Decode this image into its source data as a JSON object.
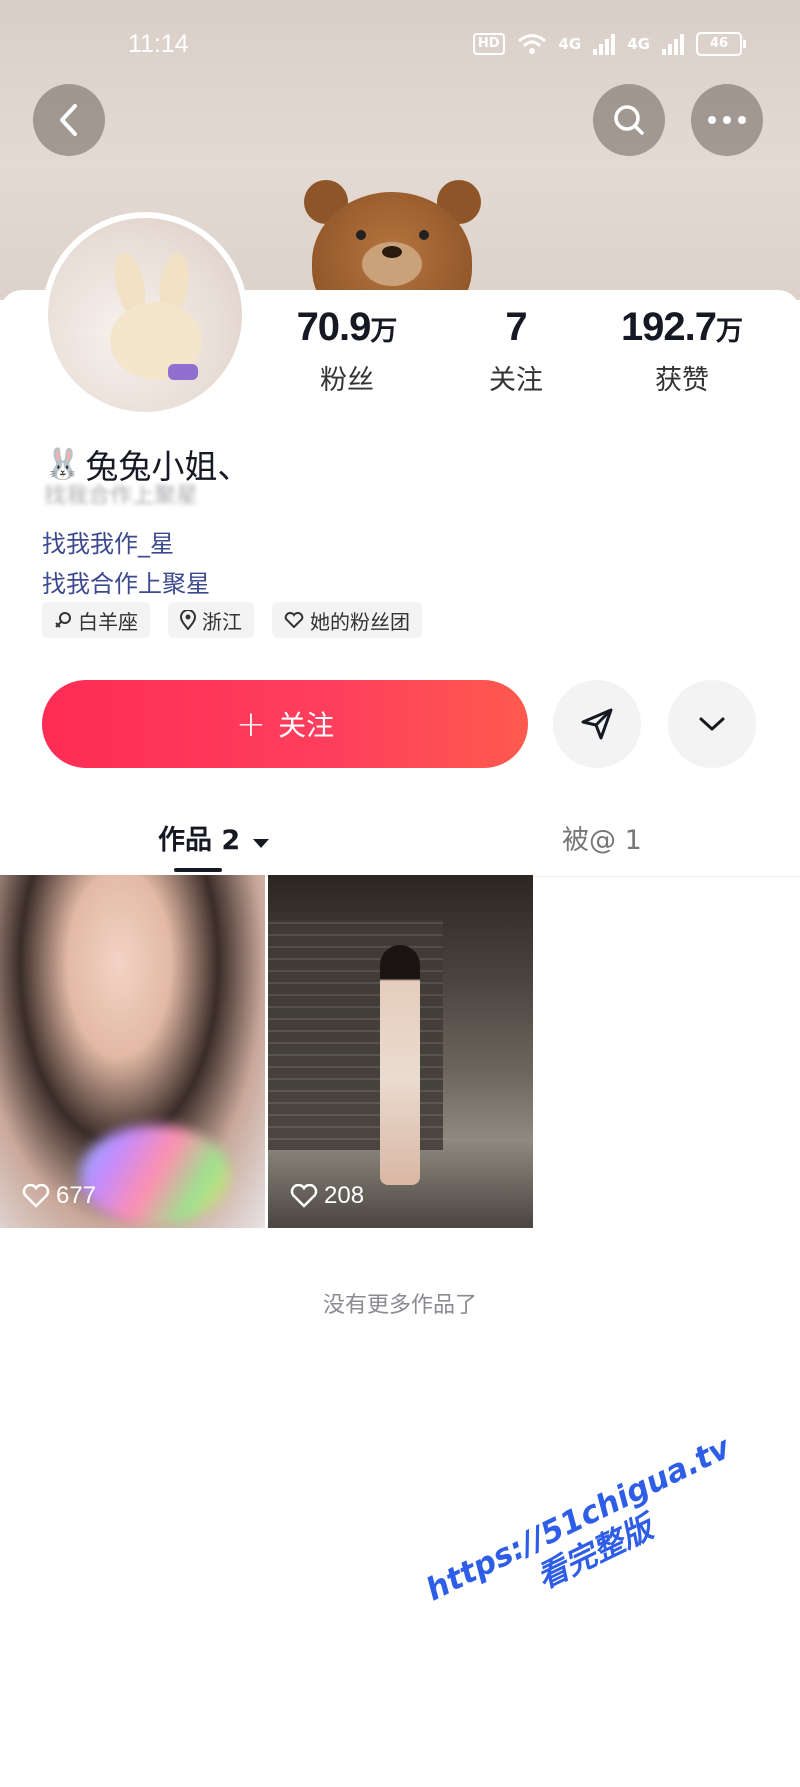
{
  "status_bar": {
    "time": "11:14",
    "hd_label": "HD",
    "network_1": "4G",
    "network_2": "4G",
    "battery": "46"
  },
  "profile": {
    "stats": [
      {
        "value": "70.9",
        "unit": "万",
        "label": "粉丝"
      },
      {
        "value": "7",
        "unit": "",
        "label": "关注"
      },
      {
        "value": "192.7",
        "unit": "万",
        "label": "获赞"
      }
    ],
    "name": "兔兔小姐、",
    "name_emoji": "🐰",
    "blurred_line": "找我合作上聚星",
    "bio": [
      "找我我作_星",
      "找我合作上聚星"
    ],
    "tags": [
      {
        "icon": "zodiac-icon",
        "label": "白羊座"
      },
      {
        "icon": "location-icon",
        "label": "浙江"
      },
      {
        "icon": "heart-icon",
        "label": "她的粉丝团"
      }
    ]
  },
  "actions": {
    "follow_label": "关注",
    "follow_plus": "+"
  },
  "tabs": [
    {
      "label": "作品 2",
      "active": true
    },
    {
      "label": "被@ 1",
      "active": false
    }
  ],
  "videos": [
    {
      "likes": "677"
    },
    {
      "likes": "208"
    }
  ],
  "empty_text": "没有更多作品了",
  "watermark": {
    "line1": "https://51chigua.tv",
    "line2": "看完整版"
  },
  "colors": {
    "accent": "#fe2c55",
    "link": "#3d4a8f",
    "watermark": "#2e5de8"
  }
}
